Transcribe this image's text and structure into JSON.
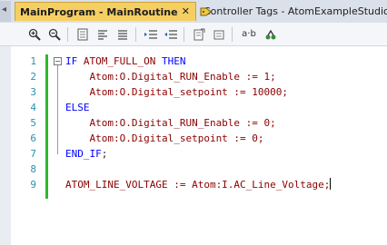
{
  "tabs": [
    {
      "label": "MainProgram - MainRoutine",
      "close": "✕",
      "active": true
    },
    {
      "label": "Controller Tags - AtomExampleStudio",
      "active": false
    }
  ],
  "toolbar": {
    "buttons": [
      "zoom-in-icon",
      "zoom-out-icon",
      "page-icon",
      "align-left-icon",
      "comment-icon",
      "uncomment-icon",
      "indent-icon",
      "outdent-icon",
      "format-icon",
      "ab-icon",
      "tags-icon"
    ],
    "ab_label": "a·b"
  },
  "editor": {
    "lines": [
      {
        "num": "1",
        "kw1": "IF",
        "text": " ATOM_FULL_ON ",
        "kw2": "THEN"
      },
      {
        "num": "2",
        "text": "    Atom:O.Digital_RUN_Enable := 1;"
      },
      {
        "num": "3",
        "text": "    Atom:O.Digital_setpoint := 10000;"
      },
      {
        "num": "4",
        "kw1": "ELSE"
      },
      {
        "num": "5",
        "text": "    Atom:O.Digital_RUN_Enable := 0;"
      },
      {
        "num": "6",
        "text": "    Atom:O.Digital_setpoint := 0;"
      },
      {
        "num": "7",
        "kw1": "END_IF",
        "text": ";"
      },
      {
        "num": "8",
        "text": ""
      },
      {
        "num": "9",
        "text": "ATOM_LINE_VOLTAGE := Atom:I.AC_Line_Voltage;"
      }
    ]
  }
}
